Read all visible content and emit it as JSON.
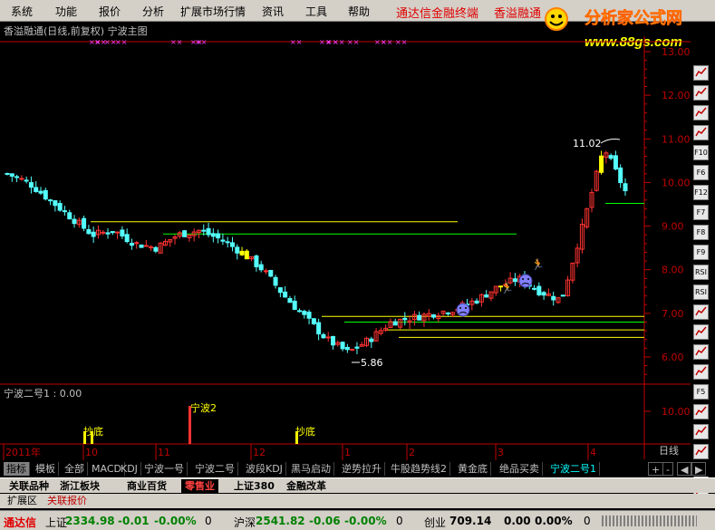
{
  "menu": {
    "items": [
      "系统",
      "功能",
      "报价",
      "分析",
      "扩展市场行情",
      "资讯",
      "工具",
      "帮助"
    ],
    "brand": "通达信金融终端",
    "brand2": "香溢融通"
  },
  "logo": {
    "text": "分析家公式网",
    "url_text": "www.88gs.com"
  },
  "chart": {
    "title": "香溢融通(日线,前复权) 宁波主图",
    "price_axis": [
      "13.00",
      "12.00",
      "11.00",
      "10.00",
      "9.00",
      "8.00",
      "7.00",
      "6.00"
    ],
    "high_label": "11.02",
    "low_label": "5.86",
    "sub_title": "宁波二号1 : 0.00",
    "sub_axis": [
      "10.00"
    ],
    "sub_labels": [
      "抄底",
      "宁波2",
      "抄底"
    ],
    "date_axis": [
      "2011年",
      "10",
      "11",
      "12",
      "1",
      "2",
      "3",
      "4"
    ],
    "period_label": "日线"
  },
  "chart_data": {
    "type": "candlestick",
    "title": "香溢融通(日线,前复权) 宁波主图",
    "ylim": [
      5.5,
      13.3
    ],
    "x": [
      "2011-09",
      "2011-10",
      "2011-11",
      "2011-12",
      "2012-01",
      "2012-02",
      "2012-03",
      "2012-04"
    ],
    "annotations": [
      {
        "text": "11.02",
        "type": "high"
      },
      {
        "text": "5.86",
        "type": "low"
      }
    ],
    "close_series_approx": [
      10.2,
      10.0,
      9.6,
      9.2,
      8.8,
      8.9,
      8.6,
      8.5,
      8.8,
      8.9,
      8.7,
      8.4,
      8.0,
      7.4,
      6.9,
      6.4,
      6.1,
      6.4,
      6.8,
      6.9,
      7.0,
      7.1,
      7.3,
      7.6,
      7.8,
      7.5,
      7.3,
      9.0,
      10.8,
      9.8
    ]
  },
  "tabs_row1": [
    "指标",
    "模板",
    "全部",
    "MACD",
    "KDJ",
    "宁波一号",
    "宁波二号",
    "波段KDJ",
    "黑马启动",
    "逆势拉升",
    "牛股趋势线2",
    "黄金底",
    "绝品买卖",
    "宁波二号1"
  ],
  "tabs_row2": [
    "关联品种",
    "浙江板块",
    "商业百货",
    "零售业",
    "上证380",
    "金融改革"
  ],
  "tabs_row3": [
    "扩展区",
    "关联报价"
  ],
  "nav_buttons": [
    "+",
    "-",
    "◀",
    "▶"
  ],
  "status": {
    "brand": "通达信",
    "sh_label": "上证",
    "sh_value": "2334.98",
    "sh_change": "-0.01",
    "sh_pct": "-0.00%",
    "sh_vol": "0",
    "hs_label": "沪深",
    "hs_value": "2541.82",
    "hs_change": "-0.06",
    "hs_pct": "-0.00%",
    "hs_vol": "0",
    "cy_label": "创业",
    "cy_value": "709.14",
    "cy_change": "0.00",
    "cy_pct": "0.00%",
    "cy_vol": "0"
  },
  "right_toolbar": [
    "tb-1",
    "tb-2",
    "tb-3",
    "tb-4",
    "F10",
    "F6",
    "F12",
    "F7",
    "F8",
    "F9",
    "RSI",
    "RSI",
    "tb-13",
    "tb-14",
    "tb-15",
    "tb-16",
    "F5",
    "tb-18",
    "tb-19",
    "tb-20",
    "tb-21",
    "tb-22"
  ],
  "colors": {
    "up": "#ff3232",
    "down": "#54ffff",
    "yellow": "#ffff00",
    "green": "#00ff00",
    "axis": "#c00000"
  }
}
